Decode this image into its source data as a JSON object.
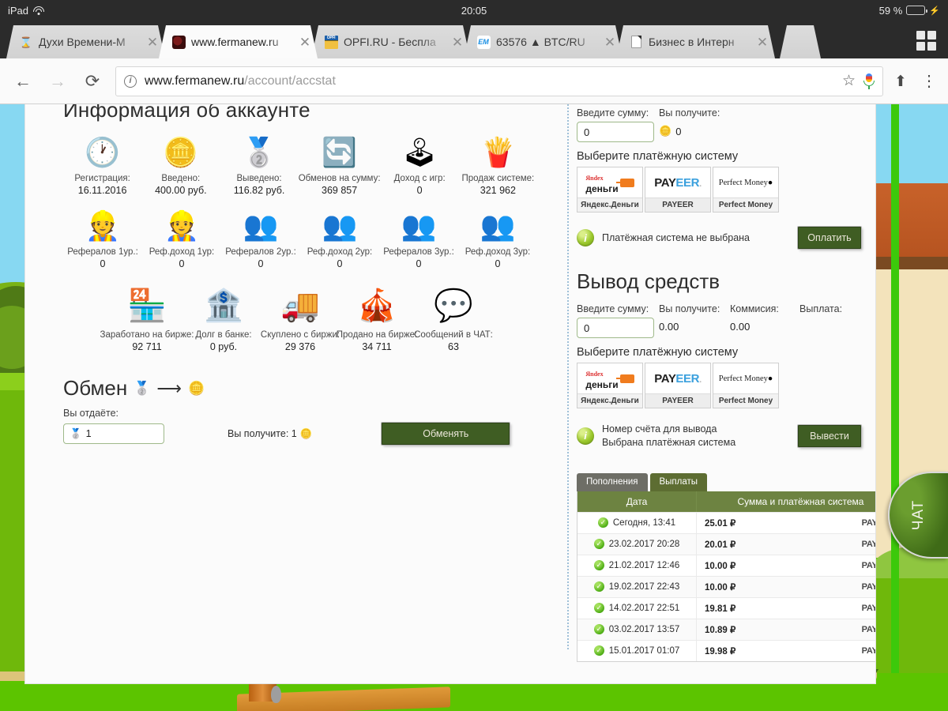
{
  "status_bar": {
    "device": "iPad",
    "wifi_icon": "wifi-icon",
    "time": "20:05",
    "battery_percent": "59 %",
    "battery_level": 59,
    "charging_icon": "lightning-bolt-icon"
  },
  "browser": {
    "tabs": [
      {
        "title": "Духи Времени-М",
        "favicon": "hourglass-icon",
        "active": false
      },
      {
        "title": "www.fermanew.ru",
        "favicon": "fox-icon",
        "active": true
      },
      {
        "title": "OPFI.RU - Беспла",
        "favicon": "opfi-icon",
        "active": false
      },
      {
        "title": "63576 ▲ BTC/RU",
        "favicon": "exmo-icon",
        "active": false
      },
      {
        "title": "Бизнес в Интерн",
        "favicon": "document-icon",
        "active": false
      }
    ],
    "close_label": "✕",
    "tabs_overview_icon": "grid-icon",
    "toolbar": {
      "back_icon": "arrow-left-icon",
      "forward_icon": "arrow-right-icon",
      "reload_icon": "reload-icon",
      "info_icon": "info-circle-icon",
      "url_host": "www.fermanew.ru",
      "url_path": "/account/accstat",
      "bookmark_icon": "star-icon",
      "voice_icon": "microphone-icon",
      "share_icon": "share-icon",
      "menu_icon": "kebab-menu-icon"
    }
  },
  "page": {
    "account_info": {
      "title": "Информация об аккаунте",
      "stats_row1": [
        {
          "icon": "clock-calendar-icon",
          "glyph": "🕐",
          "label": "Регистрация:",
          "value": "16.11.2016"
        },
        {
          "icon": "gold-coins-icon",
          "glyph": "🪙",
          "label": "Введено:",
          "value": "400.00 руб."
        },
        {
          "icon": "silver-coins-icon",
          "glyph": "🥈",
          "label": "Выведено:",
          "value": "116.82 руб."
        },
        {
          "icon": "exchange-coins-icon",
          "glyph": "🔄",
          "label": "Обменов на сумму:",
          "value": "369 857"
        },
        {
          "icon": "joystick-icon",
          "glyph": "🕹",
          "label": "Доход с игр:",
          "value": "0"
        },
        {
          "icon": "fastfood-icon",
          "glyph": "🍟",
          "label": "Продаж системе:",
          "value": "321 962"
        }
      ],
      "stats_row2": [
        {
          "icon": "workers-icon",
          "glyph": "👷",
          "label": "Рефералов 1ур.:",
          "value": "0"
        },
        {
          "icon": "workers-coins-icon",
          "glyph": "👷",
          "label": "Реф.доход 1ур:",
          "value": "0"
        },
        {
          "icon": "people-icon",
          "glyph": "👥",
          "label": "Рефералов 2ур.:",
          "value": "0"
        },
        {
          "icon": "people-coins-icon",
          "glyph": "👥",
          "label": "Реф.доход 2ур:",
          "value": "0"
        },
        {
          "icon": "people-icon",
          "glyph": "👥",
          "label": "Рефералов 3ур.:",
          "value": "0"
        },
        {
          "icon": "people-coins-icon",
          "glyph": "👥",
          "label": "Реф.доход 3ур:",
          "value": "0"
        }
      ],
      "stats_row3": [
        {
          "icon": "market-stall-icon",
          "glyph": "🏪",
          "label": "Заработано на бирже:",
          "value": "92 711"
        },
        {
          "icon": "bank-icon",
          "glyph": "🏦",
          "label": "Долг в банке:",
          "value": "0 руб."
        },
        {
          "icon": "truck-icon",
          "glyph": "🚚",
          "label": "Скуплено с биржи:",
          "value": "29 376"
        },
        {
          "icon": "stall-coins-icon",
          "glyph": "🎪",
          "label": "Продано на бирже:",
          "value": "34 711"
        },
        {
          "icon": "chat-bubbles-icon",
          "glyph": "💬",
          "label": "Сообщений в ЧАТ:",
          "value": "63"
        }
      ]
    },
    "exchange": {
      "title": "Обмен",
      "from_icon": "silver-coin-icon",
      "arrow_icon": "arrow-right-icon",
      "to_icon": "gold-coin-icon",
      "give_label": "Вы отдаёте:",
      "give_value": "1",
      "give_icon": "silver-coin-icon",
      "receive_label": "Вы получите: 1",
      "receive_icon": "gold-coin-icon",
      "button_label": "Обменять"
    },
    "deposit": {
      "amount_label": "Введите сумму:",
      "amount_value": "0",
      "receive_label": "Вы получите:",
      "receive_value": "0",
      "receive_icon": "gold-coin-icon",
      "choose_ps_label": "Выберите платёжную систему",
      "payment_systems": [
        {
          "name": "Яндекс.Деньги",
          "logo": "yandex-money-logo"
        },
        {
          "name": "PAYEER",
          "logo": "payeer-logo"
        },
        {
          "name": "Perfect Money",
          "logo": "perfect-money-logo"
        }
      ],
      "note_icon": "info-icon",
      "note": "Платёжная система не выбрана",
      "button_label": "Оплатить"
    },
    "withdraw": {
      "title": "Вывод средств",
      "amount_label": "Введите сумму:",
      "amount_value": "0",
      "receive_label": "Вы получите:",
      "receive_value": "0.00",
      "fee_label": "Коммисия:",
      "fee_value": "0.00",
      "payout_label": "Выплата:",
      "payout_value": "",
      "choose_ps_label": "Выберите платёжную систему",
      "payment_systems": [
        {
          "name": "Яндекс.Деньги",
          "logo": "yandex-money-logo"
        },
        {
          "name": "PAYEER",
          "logo": "payeer-logo"
        },
        {
          "name": "Perfect Money",
          "logo": "perfect-money-logo"
        }
      ],
      "note_icon": "info-icon",
      "note_line1": "Номер счёта для вывода",
      "note_line2": "Выбрана платёжная система",
      "button_label": "Вывести"
    },
    "history": {
      "tabs": [
        {
          "label": "Пополнения",
          "selected": false
        },
        {
          "label": "Выплаты",
          "selected": true
        }
      ],
      "columns": [
        "Дата",
        "Сумма и платёжная система"
      ],
      "rows": [
        {
          "status_icon": "check-circle-icon",
          "date": "Сегодня, 13:41",
          "amount": "25.01 ₽",
          "system": "PAYEER"
        },
        {
          "status_icon": "check-circle-icon",
          "date": "23.02.2017 20:28",
          "amount": "20.01 ₽",
          "system": "PAYEER"
        },
        {
          "status_icon": "check-circle-icon",
          "date": "21.02.2017 12:46",
          "amount": "10.00 ₽",
          "system": "PAYEER"
        },
        {
          "status_icon": "check-circle-icon",
          "date": "19.02.2017 22:43",
          "amount": "10.00 ₽",
          "system": "PAYEER"
        },
        {
          "status_icon": "check-circle-icon",
          "date": "14.02.2017 22:51",
          "amount": "19.81 ₽",
          "system": "PAYEER"
        },
        {
          "status_icon": "check-circle-icon",
          "date": "03.02.2017 13:57",
          "amount": "10.89 ₽",
          "system": "PAYEER"
        },
        {
          "status_icon": "check-circle-icon",
          "date": "15.01.2017 01:07",
          "amount": "19.98 ₽",
          "system": "PAYEER"
        }
      ]
    },
    "chat_tab": {
      "label": "ЧАТ"
    }
  },
  "colors": {
    "accent_green": "#3f5d23",
    "table_header": "#6d8341",
    "tab_selected": "#5d6d32",
    "page_bg": "#5cc400",
    "input_border": "#9fb98a"
  }
}
